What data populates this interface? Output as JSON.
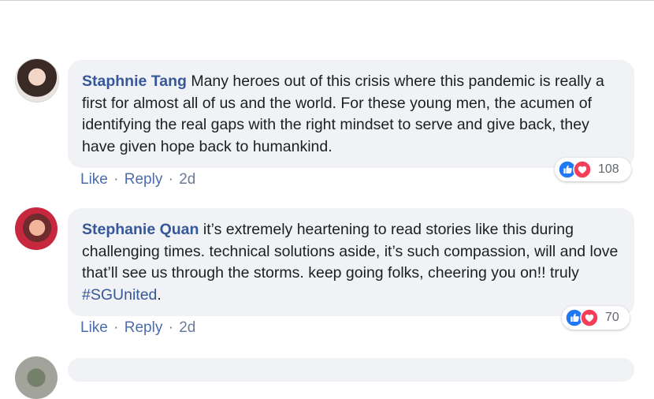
{
  "comments": [
    {
      "author": "Staphnie Tang",
      "text": "Many heroes out of this crisis where this pandemic is really a first for almost all of us and the world. For these young men, the acumen of identifying the real gaps with the right mindset to serve and give back, they have given hope back to humankind.",
      "hashtag": "",
      "like_label": "Like",
      "reply_label": "Reply",
      "separator": "·",
      "time": "2d",
      "reaction_count": "108",
      "reactions": [
        "like-icon",
        "love-icon"
      ]
    },
    {
      "author": "Stephanie Quan",
      "text": "it’s extremely heartening to read stories like this during challenging times. technical solutions aside, it’s such compassion, will and love that’ll see us through the storms. keep going folks, cheering you on!! truly",
      "hashtag": "#SGUnited",
      "after_hashtag": ".",
      "like_label": "Like",
      "reply_label": "Reply",
      "separator": "·",
      "time": "2d",
      "reaction_count": "70",
      "reactions": [
        "like-icon",
        "love-icon"
      ]
    }
  ],
  "colors": {
    "bubble": "#f0f2f5",
    "author": "#365899",
    "like_reaction": "#2078f4",
    "love_reaction": "#f33e58"
  }
}
